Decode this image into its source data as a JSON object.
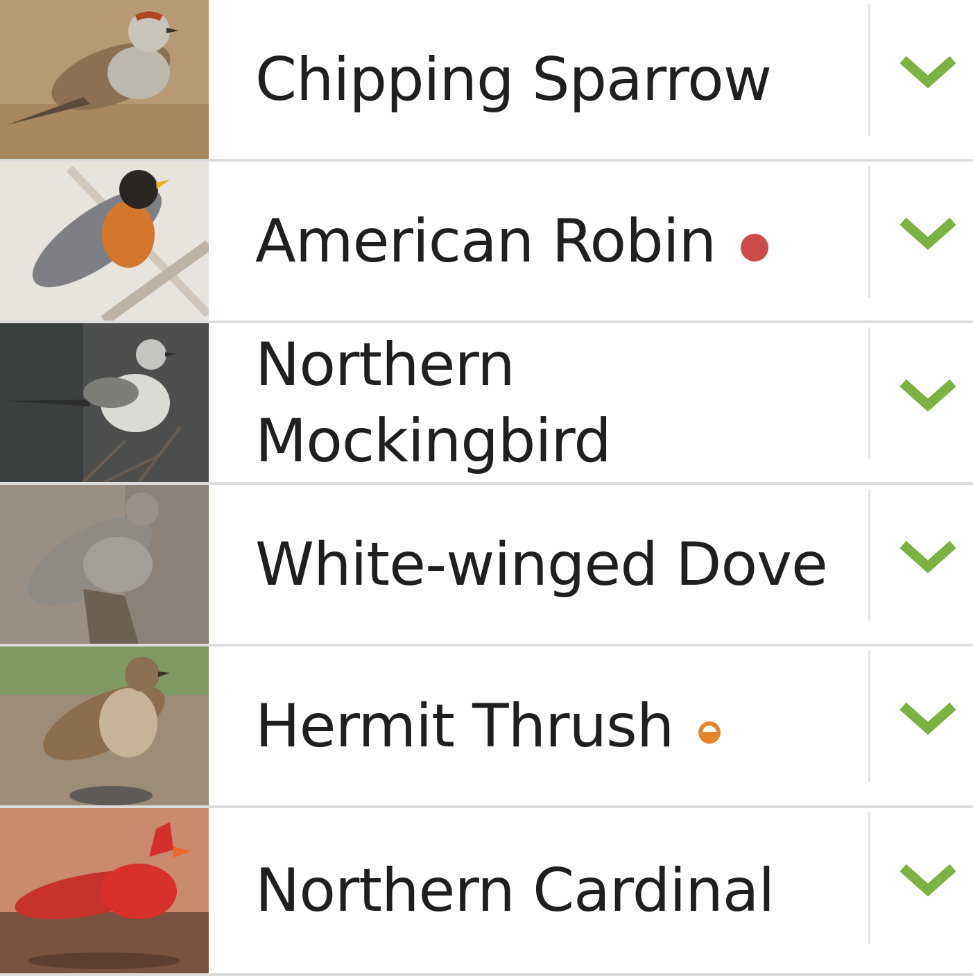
{
  "accent_check_color": "#7bb242",
  "birds": [
    {
      "name": "Chipping Sparrow",
      "photo": "chipping-sparrow-photo",
      "status": null
    },
    {
      "name": "American Robin",
      "photo": "american-robin-photo",
      "status": "red-dot"
    },
    {
      "name": "Northern Mockingbird",
      "photo": "northern-mockingbird-photo",
      "status": null
    },
    {
      "name": "White-winged Dove",
      "photo": "white-winged-dove-photo",
      "status": null
    },
    {
      "name": "Hermit Thrush",
      "photo": "hermit-thrush-photo",
      "status": "orange-half-dot"
    },
    {
      "name": "Northern Cardinal",
      "photo": "northern-cardinal-photo",
      "status": null
    }
  ],
  "icons": {
    "expand": "chevron-down-icon"
  }
}
